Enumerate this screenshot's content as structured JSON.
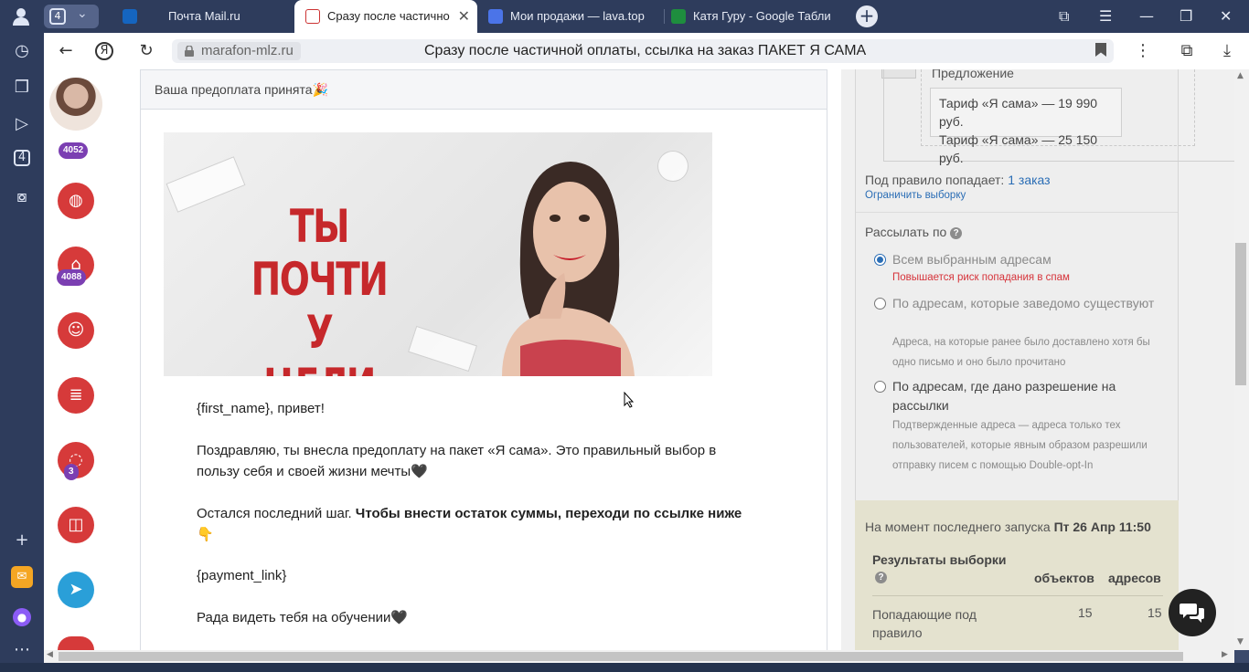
{
  "browser": {
    "tab_count": "4",
    "tabs": [
      {
        "label": "Почта Mail.ru",
        "icon": "mail-icon",
        "color": "#1565c0"
      },
      {
        "label": "Сразу после частично",
        "icon": "page-favicon-icon",
        "color": "#cc3333"
      },
      {
        "label": "Мои продажи — lava.top",
        "icon": "lava-icon",
        "color": "#4b74e8"
      },
      {
        "label": "Катя Гуру - Google Табли",
        "icon": "sheets-icon",
        "color": "#1e8e3e"
      }
    ],
    "address_domain": "marafon-mlz.ru",
    "page_title": "Сразу после частичной оплаты, ссылка на заказ ПАКЕТ Я САМА"
  },
  "sidebar": {
    "badges": [
      "4052",
      "4088",
      "3"
    ]
  },
  "email": {
    "subject": "Ваша предоплата принята🎉",
    "banner_text": "ТЫ ПОЧТИ У ЦЕЛИ",
    "greeting": "{first_name}, привет!",
    "para1": "Поздравляю, ты внесла предоплату на пакет «Я сама». Это правильный выбор в пользу себя и своей жизни мечты🖤",
    "para2_start": "Остался последний шаг. ",
    "para2_bold": "Чтобы внести остаток суммы, переходи по ссылке ниже👇",
    "payment_link": "{payment_link}",
    "closing": "Рада видеть тебя на обучении🖤"
  },
  "settings": {
    "offer_label": "Предложение",
    "offer_items": [
      "Тариф «Я сама» — 19 990 руб.",
      "Тариф «Я сама» — 25 150 руб."
    ],
    "rule_text": "Под правило попадает:",
    "rule_count": "1 заказ",
    "limit_link": "Ограничить выборку",
    "send_by_label": "Рассылать по",
    "options": [
      {
        "label": "Всем выбранным адресам",
        "selected": true,
        "note": "Повышается риск попадания в спам"
      },
      {
        "label": "По адресам, которые заведомо существуют",
        "selected": false,
        "note": "Адреса, на которые ранее было доставлено хотя бы одно письмо и оно было прочитано"
      },
      {
        "label": "По адресам, где дано разрешение на рассылки",
        "selected": false,
        "note": "Подтвержденные адреса — адреса только тех пользователей, которые явным образом разрешили отправку писем с помощью Double-opt-In"
      }
    ],
    "last_run_label": "На момент последнего запуска",
    "last_run_date": "Пт 26 Апр 11:50",
    "results_title": "Результаты выборки",
    "col_objects": "объектов",
    "col_addresses": "адресов",
    "row_label": "Попадающие под правило",
    "row_objects": "15",
    "row_addresses": "15"
  },
  "colors": {
    "accent": "#2a6db5",
    "brand_red": "#d63a3a",
    "warning": "#d6333a"
  }
}
